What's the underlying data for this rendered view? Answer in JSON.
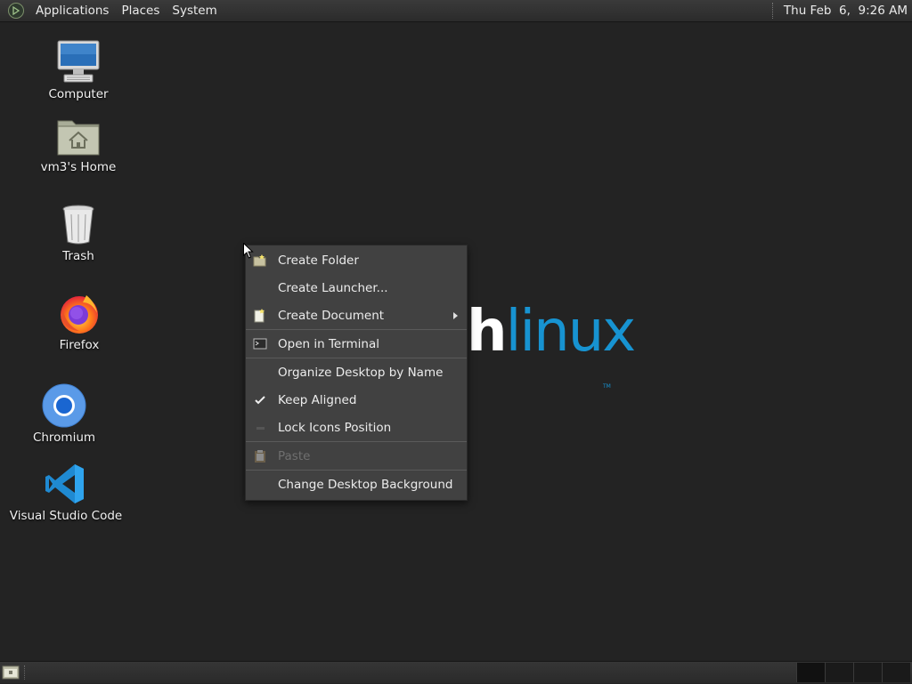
{
  "top_panel": {
    "menus": [
      "Applications",
      "Places",
      "System"
    ],
    "clock": "Thu Feb  6,  9:26 AM"
  },
  "desktop_icons": [
    {
      "label": "Computer",
      "icon": "computer-icon"
    },
    {
      "label": "vm3's Home",
      "icon": "home-folder-icon"
    },
    {
      "label": "Trash",
      "icon": "trash-icon"
    },
    {
      "label": "Firefox",
      "icon": "firefox-icon"
    },
    {
      "label": "Chromium",
      "icon": "chromium-icon"
    },
    {
      "label": "Visual Studio Code",
      "icon": "vscode-icon"
    }
  ],
  "watermark": {
    "part1": "h",
    "part2": "linux",
    "tm": "TM"
  },
  "context_menu": {
    "items": [
      {
        "label": "Create Folder",
        "icon": "new-folder-icon",
        "enabled": true
      },
      {
        "label": "Create Launcher...",
        "icon": "",
        "enabled": true
      },
      {
        "label": "Create Document",
        "icon": "new-document-icon",
        "enabled": true,
        "submenu": true
      },
      {
        "label": "Open in Terminal",
        "icon": "terminal-icon",
        "enabled": true
      },
      {
        "label": "Organize Desktop by Name",
        "icon": "",
        "enabled": true
      },
      {
        "label": "Keep Aligned",
        "icon": "checkmark-icon",
        "enabled": true,
        "checked": true
      },
      {
        "label": "Lock Icons Position",
        "icon": "checkbox-unchecked-icon",
        "enabled": true,
        "checked": false
      },
      {
        "label": "Paste",
        "icon": "paste-icon",
        "enabled": false
      },
      {
        "label": "Change Desktop Background",
        "icon": "",
        "enabled": true
      }
    ]
  },
  "colors": {
    "desktop_bg": "#232323",
    "arch_blue": "#1793d1",
    "menu_bg": "#414141"
  }
}
